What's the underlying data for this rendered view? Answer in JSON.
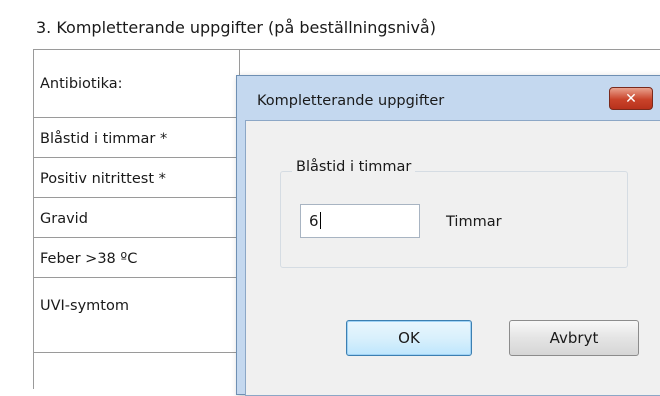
{
  "section": {
    "title": "3. Kompletterande uppgifter (på beställningsnivå)"
  },
  "form_rows": [
    {
      "label": "Antibiotika:"
    },
    {
      "label": "Blåstid i timmar *"
    },
    {
      "label": "Positiv nitrittest *"
    },
    {
      "label": "Gravid"
    },
    {
      "label": "Feber >38 ºC"
    },
    {
      "label": "UVI-symtom"
    }
  ],
  "dialog": {
    "title": "Kompletterande uppgifter",
    "close_icon": "close-icon",
    "close_glyph": "✕",
    "group_label": "Blåstid i timmar",
    "input_value": "6",
    "unit_label": "Timmar",
    "ok_label": "OK",
    "cancel_label": "Avbryt"
  },
  "colors": {
    "dialog_frame": "#c4d8ef",
    "close_button": "#c9432a",
    "default_button_border": "#3c7fb1"
  }
}
